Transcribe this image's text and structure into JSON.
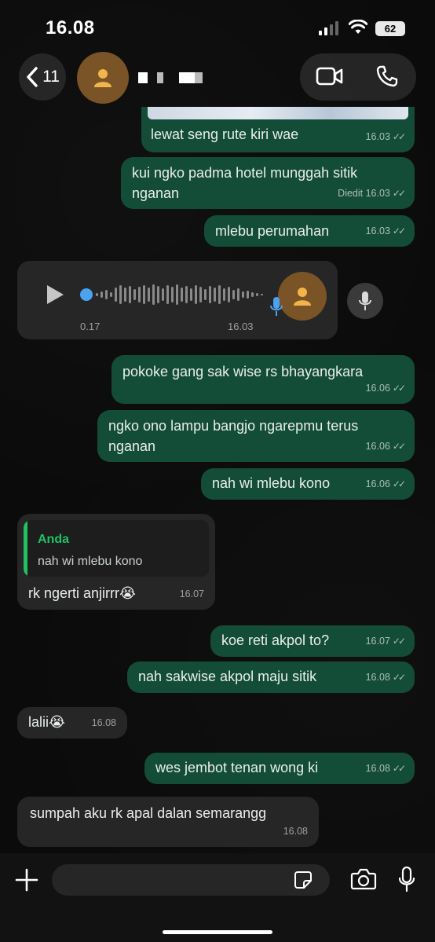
{
  "status": {
    "time": "16.08",
    "battery": "62"
  },
  "header": {
    "back_count": "11"
  },
  "messages": [
    {
      "id": "m1",
      "text": "lewat seng rute kiri wae",
      "meta": "16.03"
    },
    {
      "id": "m2",
      "text": "kui ngko padma hotel munggah sitik nganan",
      "meta": "Diedit 16.03"
    },
    {
      "id": "m3",
      "text": "mlebu perumahan",
      "meta": "16.03"
    },
    {
      "id": "m4",
      "text": "pokoke gang sak wise rs bhayangkara",
      "meta": "16.06"
    },
    {
      "id": "m5",
      "text": "ngko ono lampu bangjo ngarepmu terus nganan",
      "meta": "16.06"
    },
    {
      "id": "m6",
      "text": "nah wi mlebu kono",
      "meta": "16.06"
    },
    {
      "id": "m7",
      "text": "rk ngerti anjirrr😭",
      "meta": "16.07"
    },
    {
      "id": "m8",
      "text": "koe reti akpol to?",
      "meta": "16.07"
    },
    {
      "id": "m9",
      "text": "nah sakwise akpol maju sitik",
      "meta": "16.08"
    },
    {
      "id": "m10",
      "text": "lalii😭",
      "meta": "16.08"
    },
    {
      "id": "m11",
      "text": "wes jembot tenan wong ki",
      "meta": "16.08"
    },
    {
      "id": "m12",
      "text": "sumpah aku rk apal dalan semarangg",
      "meta": "16.08"
    }
  ],
  "voice": {
    "duration": "0.17",
    "time": "16.03"
  },
  "reply": {
    "quoted_name": "Anda",
    "quoted_text": "nah wi mlebu kono"
  },
  "composer": {
    "value": ""
  },
  "icons": {
    "back": "chevron-left-icon",
    "avatar": "person-icon",
    "video": "video-call-icon",
    "phone": "phone-icon",
    "play": "play-icon",
    "mic": "mic-icon",
    "plus": "plus-icon",
    "sticker": "sticker-icon",
    "camera": "camera-icon",
    "read": "double-check-icon"
  },
  "colors": {
    "outgoing": "#144d37",
    "incoming": "#262626",
    "accent": "#21c063",
    "avatar": "#7a5426"
  }
}
